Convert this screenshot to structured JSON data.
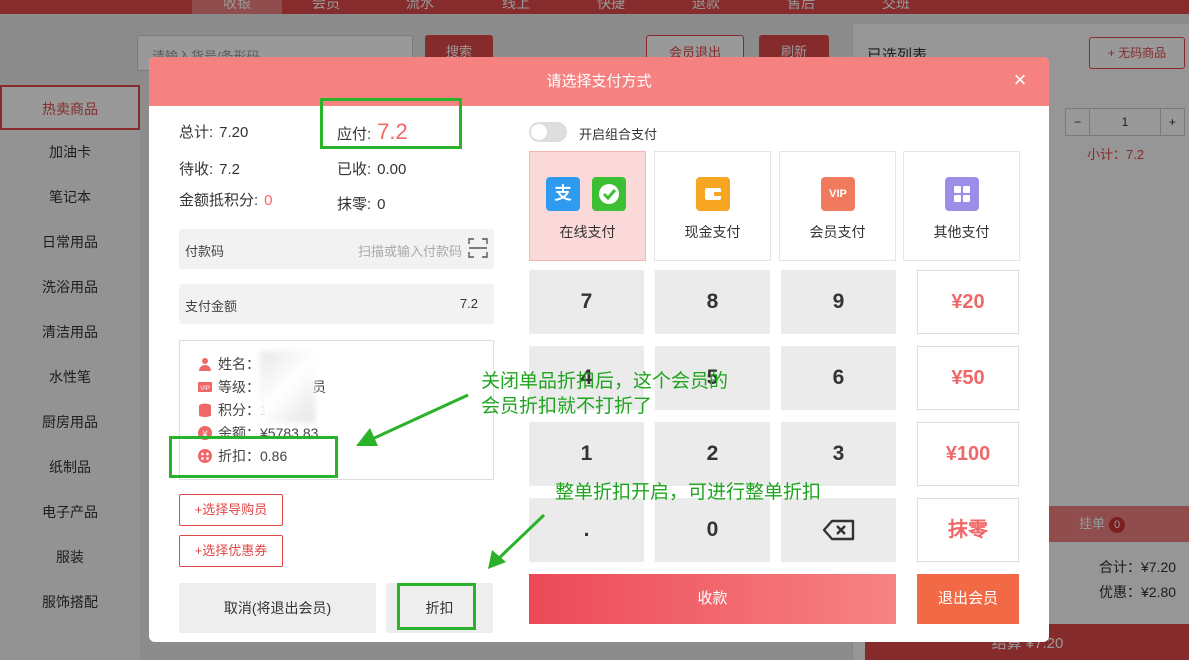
{
  "topnav": {
    "tabs": [
      "收银",
      "会员",
      "流水",
      "线上",
      "快捷",
      "退款",
      "售后",
      "交班"
    ]
  },
  "background": {
    "search_placeholder": "请输入货号/条形码",
    "search_btn": "搜索",
    "member_exit_btn": "会员退出",
    "refresh_btn": "刷新",
    "sidebar": [
      "热卖商品",
      "加油卡",
      "笔记本",
      "日常用品",
      "洗浴用品",
      "清洁用品",
      "水性笔",
      "厨房用品",
      "纸制品",
      "电子产品",
      "服装",
      "服饰搭配"
    ],
    "right": {
      "title": "已选列表",
      "no_code_btn": "+ 无码商品",
      "minus": "−",
      "qty": "1",
      "plus": "+",
      "subtotal": "小计：7.2",
      "hold_label": "挂单",
      "hold_count": "0",
      "total": "合计：¥7.20",
      "discount": "优惠：¥2.80",
      "settle": "结算 ¥7.20"
    }
  },
  "modal": {
    "title": "请选择支付方式",
    "close": "×",
    "summary": {
      "total_label": "总计:",
      "total_value": "7.20",
      "due_label": "应付:",
      "due_value": "7.2",
      "pending_label": "待收:",
      "pending_value": "7.2",
      "received_label": "已收:",
      "received_value": "0.00",
      "points_label": "金额抵积分:",
      "points_value": "0",
      "rounding_label": "抹零:",
      "rounding_value": "0"
    },
    "paycode": {
      "label": "付款码",
      "placeholder": "扫描或输入付款码"
    },
    "payamount": {
      "label": "支付金额",
      "value": "7.2"
    },
    "member": {
      "name": "姓名：",
      "level": "等级：",
      "level_tail": "员",
      "points": "积分：13",
      "balance": "余额：¥5783.83",
      "discount": "折扣：0.86"
    },
    "pick_guide": "+选择导购员",
    "pick_coupon": "+选择优惠券",
    "cancel_btn": "取消(将退出会员)",
    "discount_btn": "折扣",
    "combo_toggle": "开启组合支付",
    "pay_methods": [
      {
        "label": "在线支付",
        "icon": "alipay-wechat-icon"
      },
      {
        "label": "现金支付",
        "icon": "wallet-icon"
      },
      {
        "label": "会员支付",
        "icon": "vip-icon"
      },
      {
        "label": "其他支付",
        "icon": "grid-icon"
      }
    ],
    "keys": [
      "7",
      "8",
      "9",
      "4",
      "5",
      "6",
      "1",
      "2",
      "3",
      ".",
      "0"
    ],
    "quick_amounts": [
      "¥20",
      "¥50",
      "¥100"
    ],
    "rounding_key": "抹零",
    "collect_btn": "收款",
    "exit_member_btn": "退出会员",
    "colors": {
      "header": "#f68181",
      "accent": "#f06767",
      "annotation": "#2ab22a"
    }
  },
  "annotations": {
    "note1_line1": "关闭单品折扣后，这个会员的",
    "note1_line2": "会员折扣就不打折了",
    "note2": "整单折扣开启，可进行整单折扣"
  }
}
